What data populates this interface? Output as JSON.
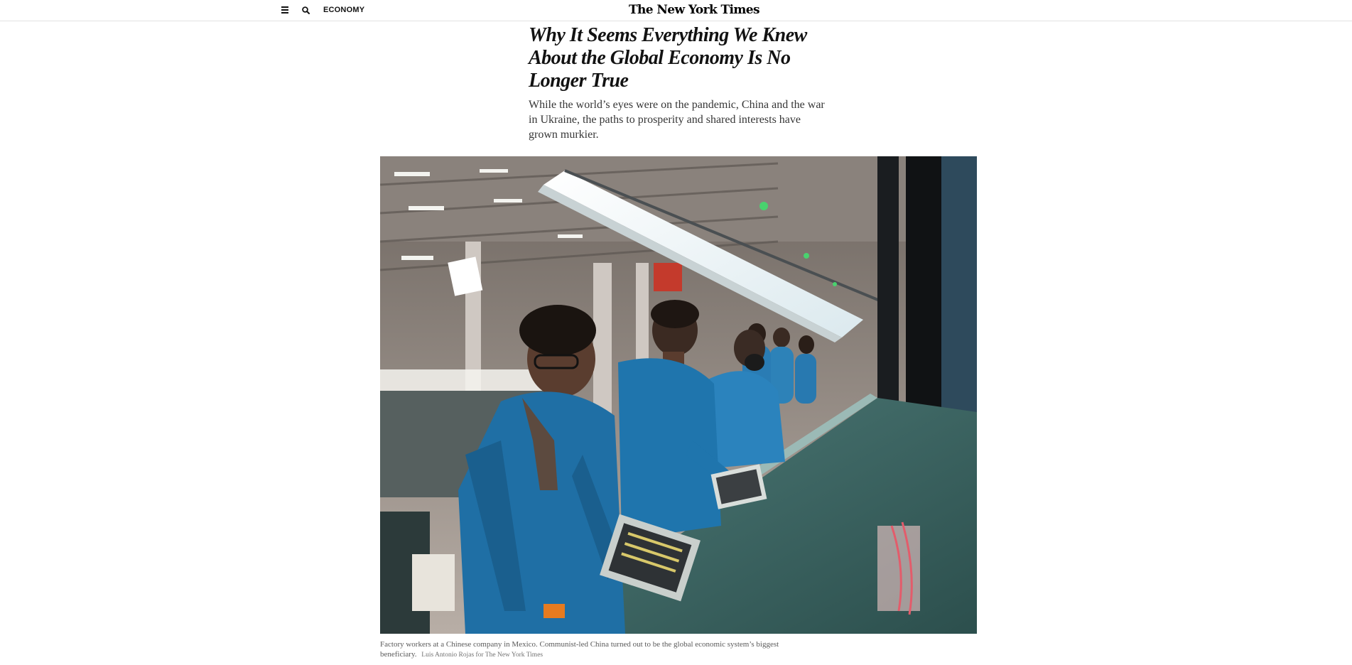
{
  "header": {
    "menu_icon": "hamburger-menu-icon",
    "search_icon": "search-icon",
    "section_label": "ECONOMY",
    "logo_text": "The New York Times"
  },
  "article": {
    "headline": "Why It Seems Everything We Knew About the Global Economy Is No Longer True",
    "summary": "While the world’s eyes were on the pandemic, China and the war in Ukraine, the paths to prosperity and shared interests have grown murkier."
  },
  "photo": {
    "caption": "Factory workers at a Chinese company in Mexico. Communist-led China turned out to be the global economic system’s biggest beneficiary.",
    "credit": "Luis Antonio Rojas for The New York Times"
  },
  "colors": {
    "text": "#121212",
    "border": "#e2e2e2",
    "jacket_blue": "#1f6fa5",
    "workbench_teal": "#3e6e6c"
  }
}
